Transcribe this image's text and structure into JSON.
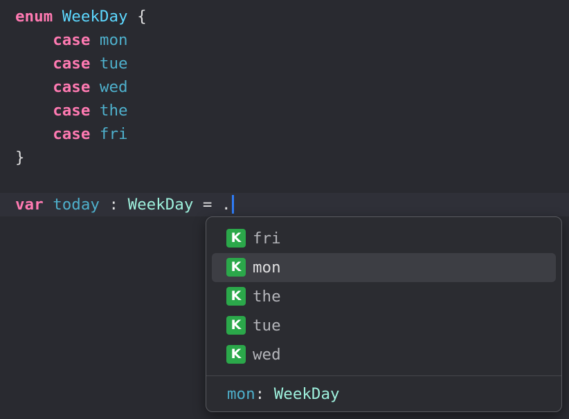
{
  "code": {
    "enum_keyword": "enum",
    "enum_name": "WeekDay",
    "open_brace": "{",
    "cases": [
      {
        "keyword": "case",
        "name": "mon"
      },
      {
        "keyword": "case",
        "name": "tue"
      },
      {
        "keyword": "case",
        "name": "wed"
      },
      {
        "keyword": "case",
        "name": "the"
      },
      {
        "keyword": "case",
        "name": "fri"
      }
    ],
    "close_brace": "}",
    "var_keyword": "var",
    "var_name": "today",
    "colon": " : ",
    "var_type": "WeekDay",
    "assign": " = .",
    "indent": "    "
  },
  "autocomplete": {
    "badge": "K",
    "items": [
      {
        "label": "fri",
        "selected": false
      },
      {
        "label": "mon",
        "selected": true
      },
      {
        "label": "the",
        "selected": false
      },
      {
        "label": "tue",
        "selected": false
      },
      {
        "label": "wed",
        "selected": false
      }
    ],
    "detail": {
      "name": "mon",
      "separator": ": ",
      "type": "WeekDay"
    }
  },
  "colors": {
    "background": "#292a30",
    "keyword": "#ff7ab2",
    "type_declaration": "#5dd8ff",
    "identifier": "#4eb0cc",
    "type": "#9ef1dd",
    "caret": "#2f7cf6",
    "badge": "#2ba84a"
  },
  "icons": {
    "completion_kind": "enum-case-badge-icon"
  }
}
